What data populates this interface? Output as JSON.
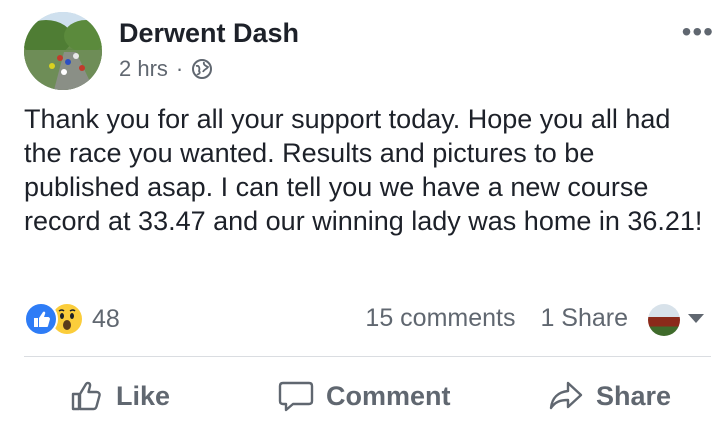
{
  "post": {
    "author": "Derwent Dash",
    "time": "2 hrs",
    "separator": "·",
    "audience_icon": "globe-icon",
    "more_label": "•••",
    "text": "Thank you for all your support today.  Hope you all had the race you wanted. Results and pictures to be published asap. I can tell you we have a new course record at 33.47 and our winning lady was home in 36.21!"
  },
  "reactions": {
    "icons": [
      "like-reaction-icon",
      "wow-reaction-icon"
    ],
    "count": "48",
    "comments": "15 comments",
    "shares": "1 Share"
  },
  "actions": {
    "like_label": "Like",
    "comment_label": "Comment",
    "share_label": "Share"
  },
  "colors": {
    "text": "#1d2129",
    "secondary": "#606770",
    "like_blue": "#2e7cf6",
    "wow_yellow": "#fbcd3b",
    "divider": "#dadde1"
  }
}
